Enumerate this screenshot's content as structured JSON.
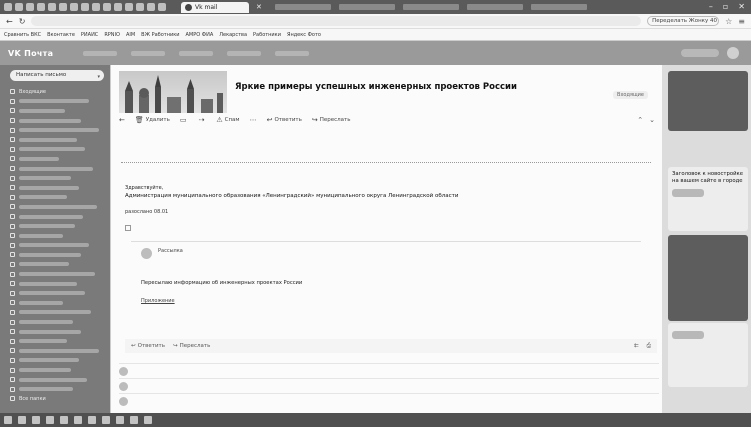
{
  "browser": {
    "active_tab": "Vk mail",
    "search_placeholder": "Переделать Жонку 40"
  },
  "bookmarks": [
    "Сравнить ВКС",
    "Вконтакте",
    "РИАИС",
    "RPNIO",
    "AIM",
    "ВЖ Работники",
    "АМРО ФИА",
    "Лекарства",
    "Работники",
    "Яндекс Фото"
  ],
  "app": {
    "logo": "VK Почта"
  },
  "sidebar": {
    "compose": "Написать письмо",
    "items": [
      {
        "label": "Входящие"
      },
      {
        "label": ""
      },
      {
        "label": ""
      },
      {
        "label": ""
      },
      {
        "label": ""
      },
      {
        "label": ""
      },
      {
        "label": ""
      },
      {
        "label": ""
      },
      {
        "label": ""
      },
      {
        "label": ""
      },
      {
        "label": ""
      },
      {
        "label": ""
      },
      {
        "label": ""
      },
      {
        "label": ""
      },
      {
        "label": ""
      },
      {
        "label": ""
      },
      {
        "label": ""
      },
      {
        "label": ""
      },
      {
        "label": ""
      },
      {
        "label": ""
      },
      {
        "label": ""
      },
      {
        "label": ""
      },
      {
        "label": ""
      },
      {
        "label": ""
      },
      {
        "label": ""
      },
      {
        "label": ""
      },
      {
        "label": ""
      },
      {
        "label": ""
      },
      {
        "label": ""
      },
      {
        "label": ""
      },
      {
        "label": ""
      },
      {
        "label": ""
      },
      {
        "label": "Все папки"
      }
    ]
  },
  "letter": {
    "subject": "Яркие примеры успешных инженерных проектов России",
    "folder": "Входящие",
    "toolbar": {
      "reply": "Ответить",
      "forward": "Переслать",
      "spam": "Спам",
      "more": "Ещё",
      "archive": "Удалить"
    },
    "greeting": "Здравствуйте,",
    "org": "Администрация муниципального образования «Ленинградский» муниципального округа Ленинградской области",
    "date": "разослано 08.01",
    "message": {
      "from": "Рассылка",
      "body": "Пересылаю информацию об инженерных проектах России",
      "link": "Приложение"
    },
    "reply_bar": {
      "reply": "Ответить",
      "forward": "Переслать"
    },
    "thread": [
      {
        "sender": "",
        "snippet": "",
        "date": ""
      },
      {
        "sender": "",
        "snippet": "",
        "date": ""
      },
      {
        "sender": "",
        "snippet": "",
        "date": ""
      }
    ]
  },
  "ads": {
    "ad1_title": "Заголовок к новостройке на вашем сайте в городе"
  },
  "colors": {
    "sidebar": "#7a7a7a",
    "header": "#9a9a9a",
    "panel": "#fbfbfb"
  }
}
